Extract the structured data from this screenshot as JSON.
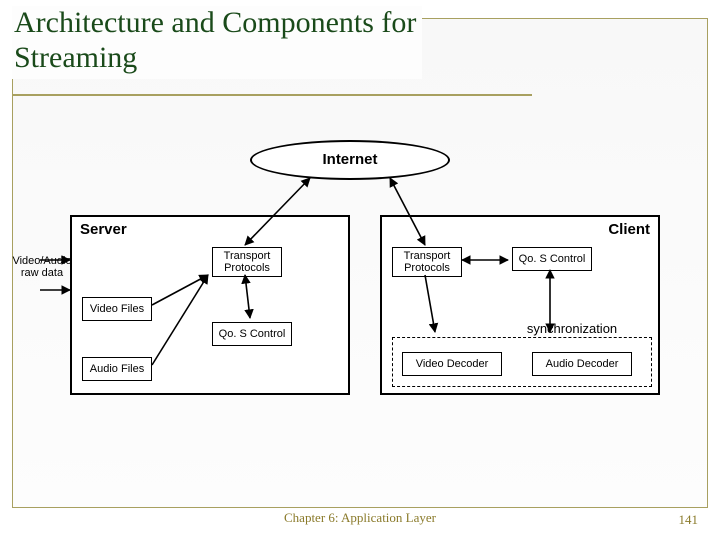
{
  "title_line1": "Architecture and Components for",
  "title_line2": "Streaming",
  "internet": "Internet",
  "server": {
    "title": "Server",
    "raw_label_l1": "Video/Audio",
    "raw_label_l2": "raw data",
    "video_files": "Video Files",
    "audio_files": "Audio Files",
    "transport": "Transport Protocols",
    "qos": "Qo. S Control"
  },
  "client": {
    "title": "Client",
    "transport": "Transport Protocols",
    "qos": "Qo. S Control",
    "sync": "synchronization",
    "video_decoder": "Video Decoder",
    "audio_decoder": "Audio Decoder"
  },
  "footer": "Chapter 6: Application Layer",
  "page": "141"
}
